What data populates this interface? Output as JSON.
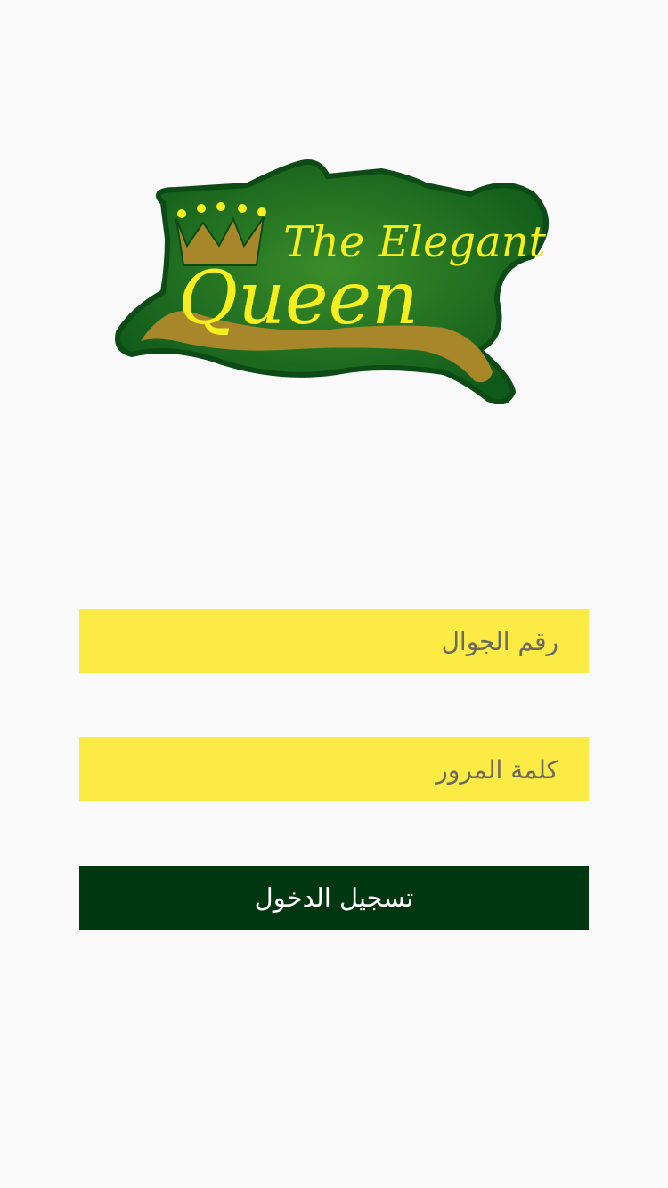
{
  "logo": {
    "line1": "The Elegant",
    "line2": "Queen",
    "colors": {
      "outline": "#0f5a1a",
      "fill": "#2c7a22",
      "text": "#f6ef1d",
      "gold": "#a8862a"
    }
  },
  "form": {
    "phone_placeholder": "رقم الجوال",
    "password_placeholder": "كلمة المرور",
    "login_label": "تسجيل الدخول"
  },
  "colors": {
    "background": "#f9f9f9",
    "field_bg": "#fcea45",
    "button_bg": "#003610",
    "button_text": "#ffffff"
  }
}
